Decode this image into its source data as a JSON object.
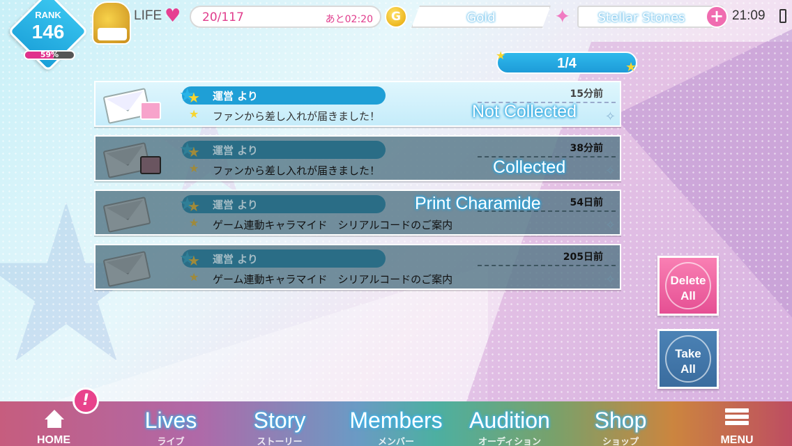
{
  "header": {
    "rank_label": "RANK",
    "rank_value": "146",
    "rank_progress_pct": "59%",
    "rank_progress": 0.59,
    "life_label": "LIFE",
    "life_value": "20/117",
    "life_timer": "あと02:20",
    "gold_icon_letter": "G",
    "gold_label": "Gold",
    "stones_label": "Stellar Stones",
    "clock": "21:09"
  },
  "pager": {
    "label": "1/4"
  },
  "mails": [
    {
      "sender": "運営 より",
      "subject": "ファンから差し入れが届きました！",
      "time": "15分前",
      "status": "Not Collected",
      "state": "unread",
      "has_gift": true
    },
    {
      "sender": "運営 より",
      "subject": "ファンから差し入れが届きました！",
      "time": "38分前",
      "status": "Collected",
      "state": "read",
      "has_gift": true
    },
    {
      "sender": "運営 より",
      "subject": "ゲーム連動キャラマイド　シリアルコードのご案内",
      "time": "54日前",
      "status": "Print Charamide",
      "state": "read",
      "has_gift": false
    },
    {
      "sender": "運営 より",
      "subject": "ゲーム連動キャラマイド　シリアルコードのご案内",
      "time": "205日前",
      "status": "",
      "state": "read",
      "has_gift": false
    }
  ],
  "actions": {
    "delete_all_line1": "Delete",
    "delete_all_line2": "All",
    "take_all_line1": "Take",
    "take_all_line2": "All"
  },
  "nav": {
    "home": "HOME",
    "lives": "Lives",
    "lives_sub": "ライブ",
    "story": "Story",
    "story_sub": "ストーリー",
    "members": "Members",
    "members_sub": "メンバー",
    "audition": "Audition",
    "audition_sub": "オーディション",
    "shop": "Shop",
    "shop_sub": "ショップ",
    "menu": "MENU",
    "notify_badge": "!"
  },
  "colors": {
    "accent_blue": "#1f9fd6",
    "accent_pink": "#e63f91",
    "delete_pink": "#e54f93",
    "take_blue": "#3a6c9e"
  }
}
